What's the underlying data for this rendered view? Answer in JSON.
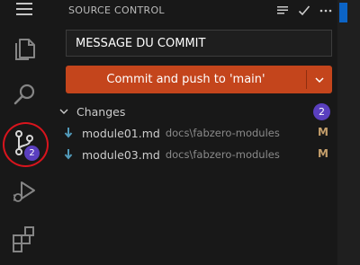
{
  "activity_bar": {
    "icons": [
      "menu-icon",
      "explorer-icon",
      "search-icon",
      "source-control-icon",
      "run-debug-icon",
      "extensions-icon"
    ],
    "source_control_badge": "2"
  },
  "panel": {
    "title": "SOURCE CONTROL",
    "title_actions": [
      "view-as-tree-icon",
      "commit-check-icon",
      "more-actions-icon"
    ]
  },
  "commit": {
    "message": "MESSAGE DU COMMIT",
    "button_label": "Commit and push to 'main'"
  },
  "changes": {
    "label": "Changes",
    "count": "2",
    "files": [
      {
        "name": "module01.md",
        "path": "docs\\fabzero-modules",
        "status": "M"
      },
      {
        "name": "module03.md",
        "path": "docs\\fabzero-modules",
        "status": "M"
      }
    ]
  },
  "colors": {
    "commit_button": "#c4451c",
    "badge": "#5a3fbf",
    "highlight": "#d8141d",
    "modified": "#c59f6b"
  }
}
